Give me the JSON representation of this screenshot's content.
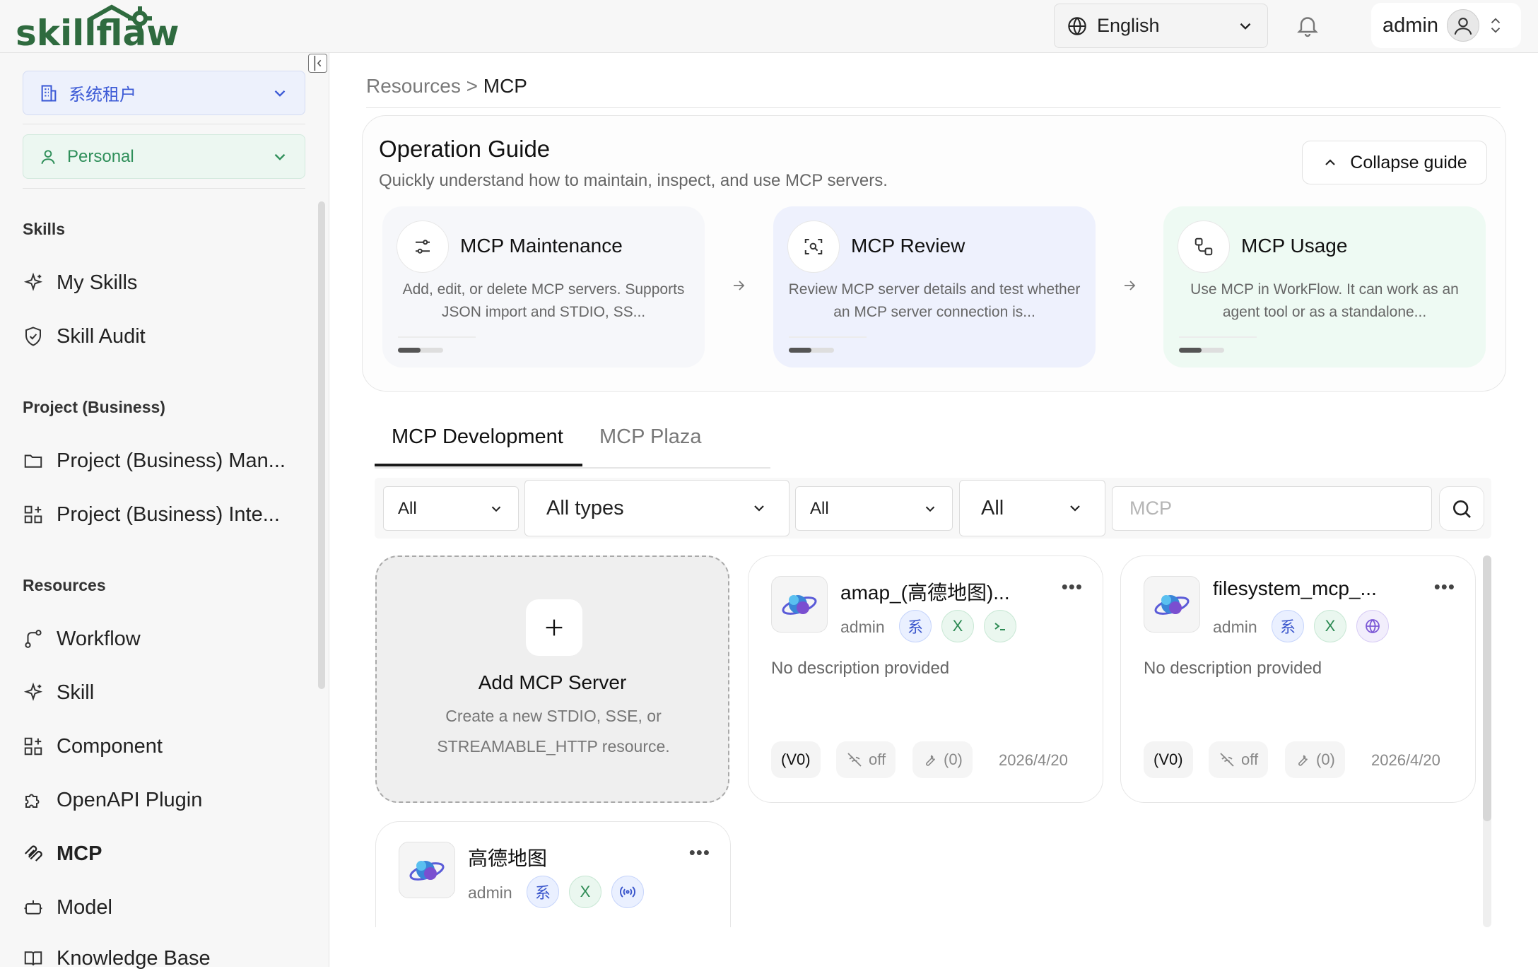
{
  "brand": {
    "logo_text": "skillflaw",
    "logo_color": "#2f6b3f"
  },
  "header": {
    "language": "English",
    "user_name": "admin"
  },
  "sidebar": {
    "tenant": "系统租户",
    "space": "Personal",
    "sections": [
      {
        "title": "Skills",
        "items": [
          {
            "label": "My Skills",
            "icon": "sparkle-icon"
          },
          {
            "label": "Skill Audit",
            "icon": "shield-check-icon"
          }
        ]
      },
      {
        "title": "Project (Business)",
        "items": [
          {
            "label": "Project (Business) Man...",
            "icon": "folder-icon"
          },
          {
            "label": "Project (Business) Inte...",
            "icon": "grid-plus-icon"
          }
        ]
      },
      {
        "title": "Resources",
        "items": [
          {
            "label": "Workflow",
            "icon": "workflow-icon"
          },
          {
            "label": "Skill",
            "icon": "sparkle-icon"
          },
          {
            "label": "Component",
            "icon": "grid-plus-icon"
          },
          {
            "label": "OpenAPI Plugin",
            "icon": "puzzle-icon"
          },
          {
            "label": "MCP",
            "icon": "mcp-icon",
            "active": true
          },
          {
            "label": "Model",
            "icon": "robot-icon"
          },
          {
            "label": "Knowledge Base",
            "icon": "book-icon"
          }
        ]
      }
    ]
  },
  "breadcrumb": {
    "parent": "Resources",
    "separator": ">",
    "current": "MCP"
  },
  "guide": {
    "title": "Operation Guide",
    "subtitle": "Quickly understand how to maintain, inspect, and use MCP servers.",
    "collapse_label": "Collapse guide",
    "cards": [
      {
        "title": "MCP Maintenance",
        "desc": "Add, edit, or delete MCP servers. Supports JSON import and STDIO, SS...",
        "bg": "#f7f8fb",
        "icon": "sliders-icon"
      },
      {
        "title": "MCP Review",
        "desc": "Review MCP server details and test whether an MCP server connection is...",
        "bg": "#eef1fd",
        "icon": "scan-search-icon"
      },
      {
        "title": "MCP Usage",
        "desc": "Use MCP in WorkFlow. It can work as an agent tool or as a standalone...",
        "bg": "#eefaf3",
        "icon": "nodes-icon"
      }
    ]
  },
  "tabs": [
    {
      "label": "MCP Development",
      "active": true
    },
    {
      "label": "MCP Plaza",
      "active": false
    }
  ],
  "filters": {
    "scope": "All",
    "type": "All types",
    "status": "All",
    "owner": "All",
    "search_placeholder": "MCP"
  },
  "add_card": {
    "title": "Add MCP Server",
    "desc": "Create a new STDIO, SSE, or STREAMABLE_HTTP resource."
  },
  "servers": [
    {
      "name": "amap_(高德地图)...",
      "owner": "admin",
      "badge_sys": "系",
      "badge_x": "X",
      "transport_icon": "terminal-icon",
      "desc": "No description provided",
      "version": "(V0)",
      "status": "off",
      "tools": "(0)",
      "date": "2026/4/20"
    },
    {
      "name": "filesystem_mcp_...",
      "owner": "admin",
      "badge_sys": "系",
      "badge_x": "X",
      "transport_icon": "globe-icon",
      "desc": "No description provided",
      "version": "(V0)",
      "status": "off",
      "tools": "(0)",
      "date": "2026/4/20"
    },
    {
      "name": "高德地图",
      "owner": "admin",
      "badge_sys": "系",
      "badge_x": "X",
      "transport_icon": "broadcast-icon",
      "desc": "",
      "version": "",
      "status": "",
      "tools": "",
      "date": ""
    }
  ]
}
